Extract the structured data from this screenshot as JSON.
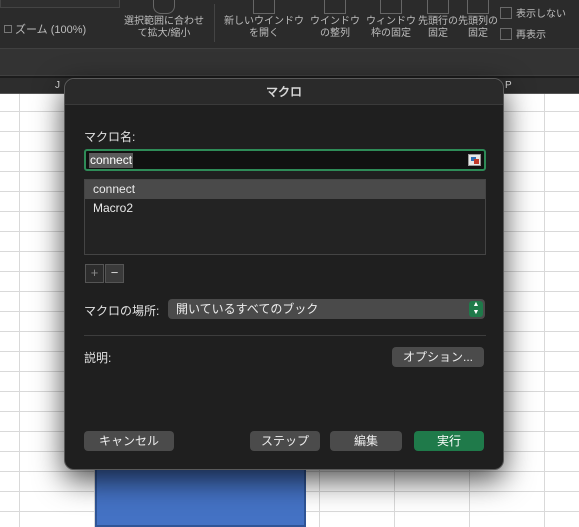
{
  "ribbon": {
    "zoom_label": "ズーム (100%)",
    "fit_selection": "選択範囲に合わせて拡大/縮小",
    "new_window": "新しいウインドウを開く",
    "arrange_windows": "ウインドウの整列",
    "freeze_panes": "ウィンドウ枠の固定",
    "freeze_top_row": "先頭行の固定",
    "freeze_first_col": "先頭列の固定",
    "hide": "表示しない",
    "unhide": "再表示"
  },
  "sheet": {
    "col_j": "J",
    "col_p": "P"
  },
  "dialog": {
    "title": "マクロ",
    "macro_name_label": "マクロ名:",
    "macro_name_value": "connect",
    "macros": [
      "connect",
      "Macro2"
    ],
    "add_symbol": "+",
    "remove_symbol": "−",
    "location_label": "マクロの場所:",
    "location_value": "開いているすべてのブック",
    "description_label": "説明:",
    "options_button": "オプション...",
    "cancel_button": "キャンセル",
    "step_button": "ステップ",
    "edit_button": "編集",
    "run_button": "実行"
  },
  "colors": {
    "accent_green": "#1f7a4a",
    "selection_blue": "#4472c4"
  }
}
